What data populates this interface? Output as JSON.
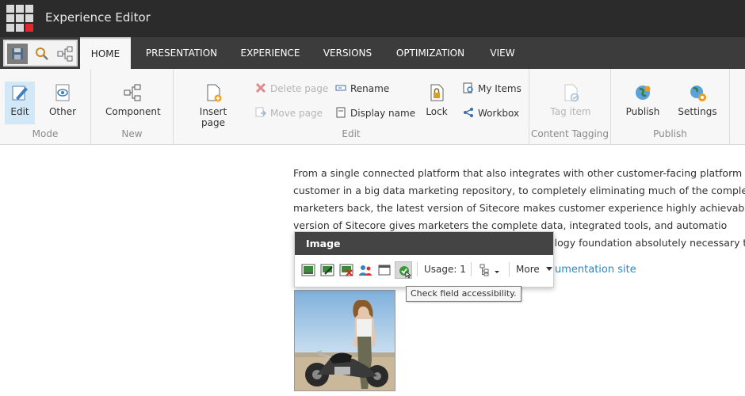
{
  "app": {
    "title": "Experience Editor"
  },
  "tabs": [
    {
      "label": "HOME",
      "active": true
    },
    {
      "label": "PRESENTATION"
    },
    {
      "label": "EXPERIENCE"
    },
    {
      "label": "VERSIONS"
    },
    {
      "label": "OPTIMIZATION"
    },
    {
      "label": "VIEW"
    }
  ],
  "ribbon": {
    "mode": {
      "label": "Mode",
      "edit": "Edit",
      "other": "Other"
    },
    "new": {
      "label": "New",
      "component": "Component"
    },
    "edit": {
      "label": "Edit",
      "insert_page": "Insert page",
      "delete_page": "Delete page",
      "move_page": "Move page",
      "rename": "Rename",
      "display_name": "Display name",
      "lock": "Lock",
      "my_items": "My Items",
      "workbox": "Workbox"
    },
    "content_tagging": {
      "label": "Content Tagging",
      "tag_item": "Tag item"
    },
    "publish": {
      "label": "Publish",
      "publish": "Publish",
      "settings": "Settings"
    }
  },
  "article": {
    "lines": [
      "From a single connected platform that also integrates with other customer-facing platform",
      "customer in a big data marketing repository, to completely eliminating much of the complexit",
      "marketers back, the latest version of Sitecore makes customer experience highly achievab",
      "version of Sitecore gives marketers the complete data, integrated tools, and automatio",
      "ology foundation absolutely necessary t"
    ],
    "link": "umentation site"
  },
  "chrome": {
    "title": "Image",
    "usage": "Usage: 1",
    "more": "More"
  },
  "tooltip": "Check field accessibility.",
  "colors": {
    "topbar": "#2b2b2b",
    "tabbar": "#3c3c3c",
    "ribbon": "#f7f7f7",
    "accent_blue": "#2b87c5",
    "brand_red": "#e0282e",
    "chrome_header": "#444444"
  }
}
